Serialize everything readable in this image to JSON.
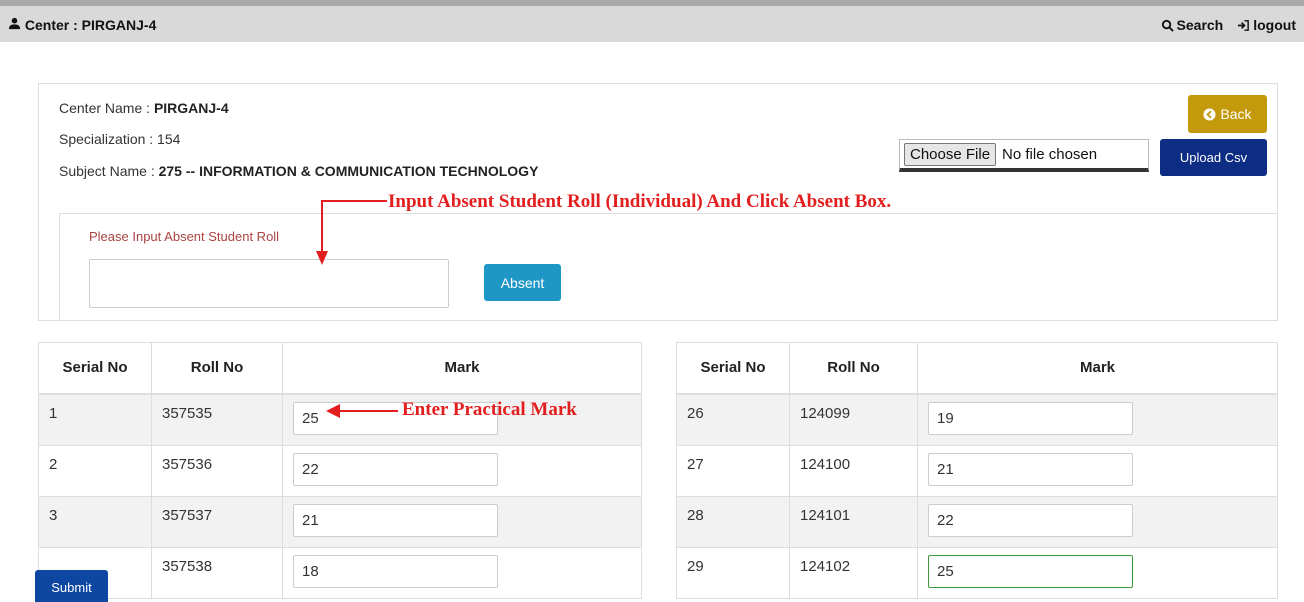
{
  "topbar": {
    "center_label": "Center : PIRGANJ-4",
    "search_label": "Search",
    "logout_label": "logout"
  },
  "info": {
    "center_name_label": "Center Name : ",
    "center_name_value": "PIRGANJ-4",
    "specialization_label": "Specialization : 154",
    "subject_name_label": "Subject Name : ",
    "subject_name_value": "275 -- INFORMATION & COMMUNICATION TECHNOLOGY"
  },
  "buttons": {
    "back": "Back",
    "upload_csv": "Upload Csv",
    "absent": "Absent",
    "submit": "Submit"
  },
  "file_input": {
    "choose_label": "Choose File",
    "status": "No file chosen"
  },
  "absent_section": {
    "label": "Please Input Absent Student Roll",
    "value": ""
  },
  "annotations": {
    "absent_instruction": "Input Absent Student Roll (Individual) And Click Absent Box.",
    "mark_instruction": "Enter Practical Mark"
  },
  "table_headers": [
    "Serial No",
    "Roll No",
    "Mark"
  ],
  "left_rows": [
    {
      "serial": "1",
      "roll": "357535",
      "mark": "25"
    },
    {
      "serial": "2",
      "roll": "357536",
      "mark": "22"
    },
    {
      "serial": "3",
      "roll": "357537",
      "mark": "21"
    },
    {
      "serial": "",
      "roll": "357538",
      "mark": "18"
    }
  ],
  "right_rows": [
    {
      "serial": "26",
      "roll": "124099",
      "mark": "19"
    },
    {
      "serial": "27",
      "roll": "124100",
      "mark": "21"
    },
    {
      "serial": "28",
      "roll": "124101",
      "mark": "22"
    },
    {
      "serial": "29",
      "roll": "124102",
      "mark": "25"
    }
  ],
  "colors": {
    "back_button": "#c49a0d",
    "upload_button": "#0d2d84",
    "absent_button": "#1e97c7",
    "submit_button": "#0d47a1",
    "annotation": "#e31e1e"
  }
}
